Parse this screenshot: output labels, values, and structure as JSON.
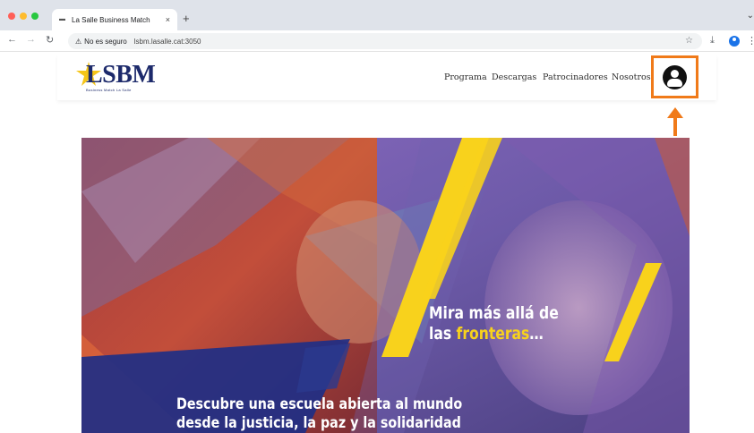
{
  "browser": {
    "tab_title": "La Salle Business Match",
    "tab_close": "×",
    "new_tab": "+",
    "tab_menu": "⌄",
    "security_text": "No es seguro",
    "url": "lsbm.lasalle.cat:3050",
    "icons": [
      "back-icon",
      "forward-icon",
      "reload-icon",
      "warning-icon",
      "star-icon",
      "download-icon",
      "profile-icon",
      "menu-icon"
    ]
  },
  "site": {
    "logo_text": "LSBM",
    "logo_tagline": "Business Match La Salle",
    "nav": [
      "Programa",
      "Descargas",
      "Patrocinadores",
      "Nosotros"
    ],
    "user_icon": "user-icon",
    "highlight_color": "#f07a19"
  },
  "hero": {
    "title_line1": "Mira más allá de",
    "title_line2_a": "las ",
    "title_line2_b": "fronteras",
    "title_line2_c": "…",
    "subtitle_line1": "Descubre una escuela abierta al mundo",
    "subtitle_line2": "desde la justicia, la paz y la solidaridad",
    "accent_yellow": "#f8d21c",
    "accent_blue": "#1f2f86"
  }
}
